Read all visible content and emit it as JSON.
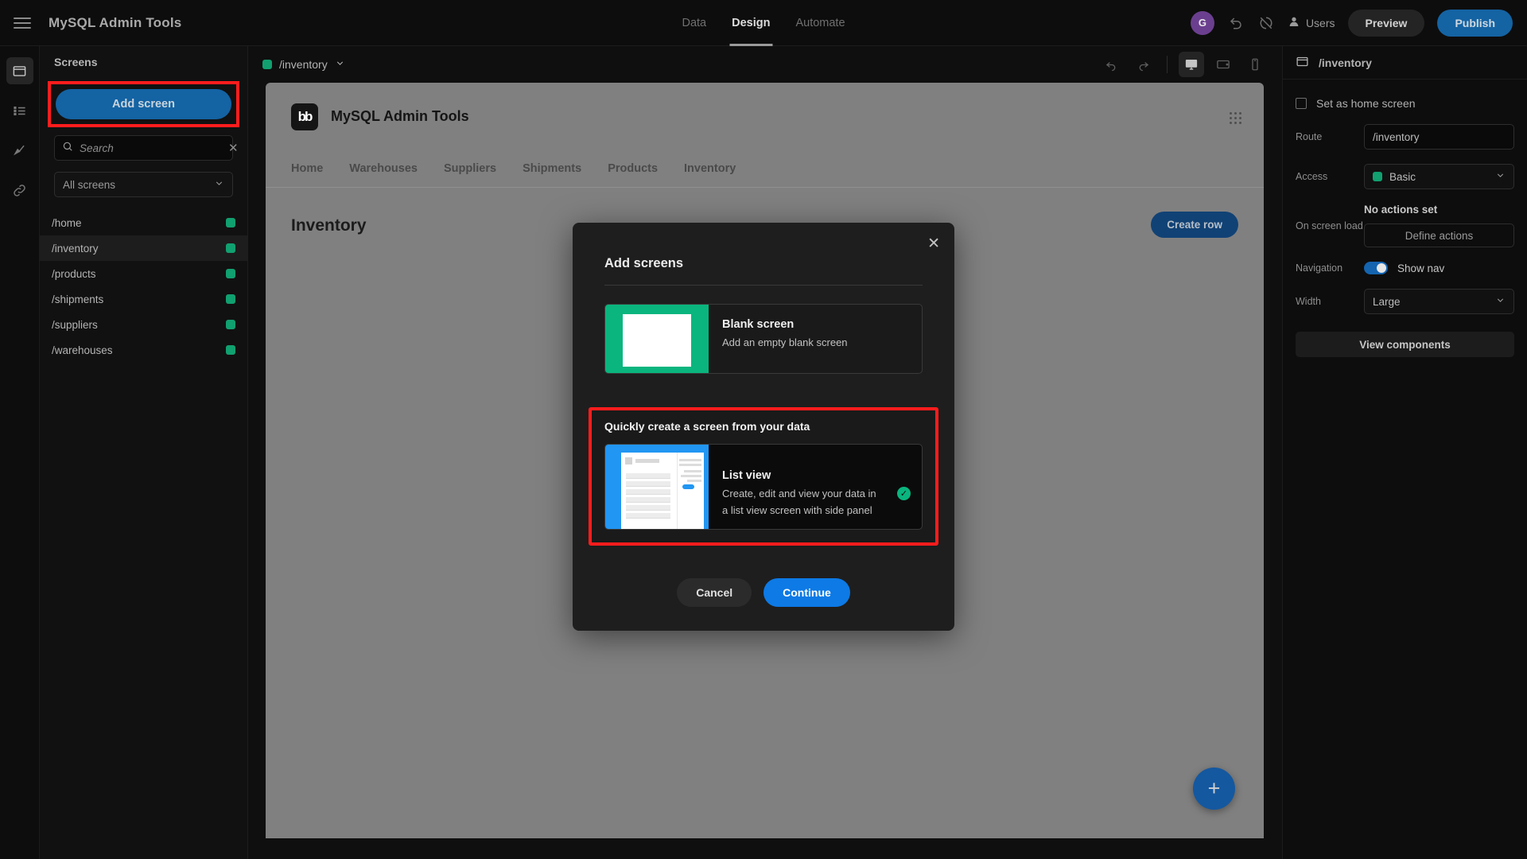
{
  "topbar": {
    "menu_icon": "hamburger-icon",
    "app_title": "MySQL Admin Tools",
    "tabs": [
      {
        "label": "Data",
        "active": false
      },
      {
        "label": "Design",
        "active": true
      },
      {
        "label": "Automate",
        "active": false
      }
    ],
    "avatar_initial": "G",
    "undo_icon": "undo-icon",
    "revert_icon": "revert-icon",
    "users_label": "Users",
    "preview_label": "Preview",
    "publish_label": "Publish",
    "publish_color": "#1463a3"
  },
  "rail": {
    "items": [
      {
        "icon": "screen-icon",
        "active": true
      },
      {
        "icon": "list-icon",
        "active": false
      },
      {
        "icon": "brush-icon",
        "active": false
      },
      {
        "icon": "link-icon",
        "active": false
      }
    ]
  },
  "screens_panel": {
    "heading": "Screens",
    "add_screen_label": "Add screen",
    "search_placeholder": "Search",
    "search_value": "",
    "filter_label": "All screens",
    "items": [
      {
        "route": "/home",
        "selected": false,
        "access_color": "#11a06f"
      },
      {
        "route": "/inventory",
        "selected": true,
        "access_color": "#11a06f"
      },
      {
        "route": "/products",
        "selected": false,
        "access_color": "#11a06f"
      },
      {
        "route": "/shipments",
        "selected": false,
        "access_color": "#11a06f"
      },
      {
        "route": "/suppliers",
        "selected": false,
        "access_color": "#11a06f"
      },
      {
        "route": "/warehouses",
        "selected": false,
        "access_color": "#11a06f"
      }
    ]
  },
  "canvas": {
    "route_chip": "/inventory",
    "undo_icon": "undo-icon",
    "redo_icon": "redo-icon",
    "devices": [
      {
        "icon": "desktop-icon",
        "active": true
      },
      {
        "icon": "tablet-icon",
        "active": false
      },
      {
        "icon": "mobile-icon",
        "active": false
      }
    ],
    "preview": {
      "logo_text": "bb",
      "app_name": "MySQL Admin Tools",
      "nav": [
        "Home",
        "Warehouses",
        "Suppliers",
        "Shipments",
        "Products",
        "Inventory"
      ],
      "page_heading": "Inventory",
      "create_row_label": "Create row",
      "fab_icon": "plus-icon"
    }
  },
  "right_panel": {
    "title": "/inventory",
    "home_screen_label": "Set as home screen",
    "home_screen_checked": false,
    "route_label": "Route",
    "route_value": "/inventory",
    "access_label": "Access",
    "access_value": "Basic",
    "access_color": "#0ea06f",
    "onload_label": "On screen load",
    "onload_value": "No actions set",
    "define_actions_label": "Define actions",
    "navigation_label": "Navigation",
    "show_nav_label": "Show nav",
    "show_nav_on": true,
    "width_label": "Width",
    "width_value": "Large",
    "view_components_label": "View components"
  },
  "modal": {
    "title": "Add screens",
    "close_icon": "close-icon",
    "blank": {
      "title": "Blank screen",
      "desc": "Add an empty blank screen",
      "thumb_color": "#0ab57e"
    },
    "data_section_title": "Quickly create a screen from your data",
    "list_view": {
      "title": "List view",
      "desc_line1": "Create, edit and view your data in",
      "desc_line2": "a list view screen with side panel",
      "selected": true,
      "thumb_color": "#2196f3",
      "check_icon": "check-circle-icon"
    },
    "cancel_label": "Cancel",
    "continue_label": "Continue",
    "highlight_color": "#ff1c1c"
  }
}
